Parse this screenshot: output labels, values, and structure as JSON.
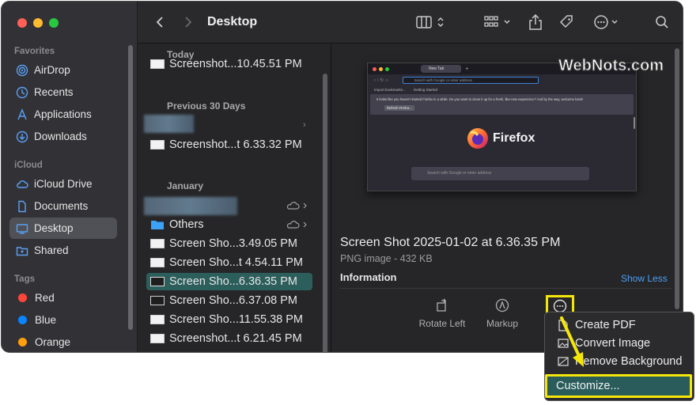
{
  "window": {
    "title": "Desktop"
  },
  "sidebar": {
    "favorites_header": "Favorites",
    "favorites": [
      {
        "label": "AirDrop",
        "icon": "airdrop-icon"
      },
      {
        "label": "Recents",
        "icon": "clock-icon"
      },
      {
        "label": "Applications",
        "icon": "applications-icon"
      },
      {
        "label": "Downloads",
        "icon": "downloads-icon"
      }
    ],
    "icloud_header": "iCloud",
    "icloud": [
      {
        "label": "iCloud Drive",
        "icon": "cloud-icon"
      },
      {
        "label": "Documents",
        "icon": "document-icon"
      },
      {
        "label": "Desktop",
        "icon": "desktop-icon",
        "selected": true
      },
      {
        "label": "Shared",
        "icon": "shared-folder-icon"
      }
    ],
    "tags_header": "Tags",
    "tags": [
      {
        "label": "Red",
        "color": "#ff453a"
      },
      {
        "label": "Blue",
        "color": "#0a84ff"
      },
      {
        "label": "Orange",
        "color": "#ff9f0a"
      }
    ]
  },
  "list": {
    "groups": {
      "today": "Today",
      "prev30": "Previous 30 Days",
      "january": "January"
    },
    "rows": {
      "today_1": "Screenshot...10.45.51 PM",
      "prev_2": "Screenshot...t 6.33.32 PM",
      "others": "Others",
      "jan_1": "Screen Sho...3.49.05 PM",
      "jan_2": "Screen Sho...t 4.54.11 PM",
      "jan_3": "Screen Sho...6.36.35 PM",
      "jan_4": "Screen Sho...6.37.08 PM",
      "jan_5": "Screen Sho...11.55.38 PM",
      "jan_6": "Screenshot...t 6.21.45 PM"
    }
  },
  "preview": {
    "filename": "Screen Shot 2025-01-02 at 6.36.35 PM",
    "meta": "PNG image - 432 KB",
    "info_header": "Information",
    "show_less": "Show Less",
    "actions": {
      "rotate": "Rotate Left",
      "markup": "Markup"
    },
    "thumb": {
      "tab": "New Tab",
      "address": "Search with Google or enter address",
      "bookmark1": "Import bookmarks...",
      "bookmark2": "Getting Started",
      "notice": "It looks like you haven't started Firefox in a while. Do you want to clean it up for a fresh, like-new experience? And by the way, welcome back!",
      "refresh": "Refresh Firefox...",
      "brand": "Firefox",
      "search": "Search with Google or enter address"
    }
  },
  "menu": {
    "items": [
      "Create PDF",
      "Convert Image",
      "Remove Background"
    ],
    "customize": "Customize..."
  },
  "watermark": "WebNots.com",
  "colors": {
    "accent": "#2c5e5c",
    "highlight": "#f5e60a",
    "link": "#4a9ff5"
  }
}
